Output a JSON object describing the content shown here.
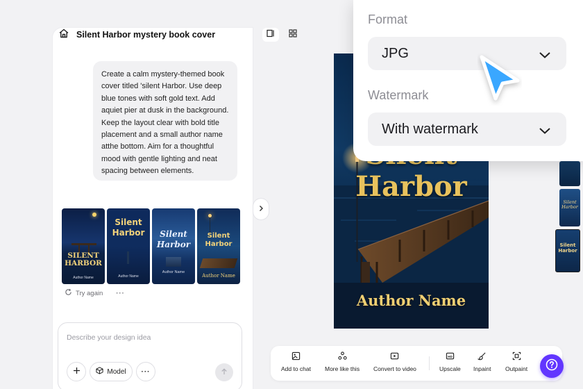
{
  "chat": {
    "title": "Silent Harbor mystery book cover",
    "prompt_message": "Create a calm mystery-themed book cover titled 'silent Harbor. Use deep blue tones with soft gold text. Add aquiet pier at dusk in the background. Keep the layout clear with bold title placement and a small author name atthe bottom. Aim for a thoughtful mood with gentle lighting and neat spacing between elements.",
    "thumbnails": [
      {
        "title": "SILENT HARBOR",
        "author": "Author Name"
      },
      {
        "title": "Silent Harbor",
        "author": "Author Name"
      },
      {
        "title": "Silent Harbor",
        "author": "Author Name"
      },
      {
        "title": "Silent Harbor",
        "author": "Author Name"
      }
    ],
    "try_again": "Try again",
    "more": "···",
    "input_placeholder": "Describe your design idea",
    "model_label": "Model",
    "dots_label": "···"
  },
  "cover": {
    "title_line1": "Silent",
    "title_line2": "Harbor",
    "author": "Author Name"
  },
  "toolbar": {
    "add_to_chat": "Add to chat",
    "more_like_this": "More like this",
    "convert_to_video": "Convert to video",
    "upscale": "Upscale",
    "inpaint": "Inpaint",
    "outpaint": "Outpaint"
  },
  "popup": {
    "format_label": "Format",
    "format_value": "JPG",
    "watermark_label": "Watermark",
    "watermark_value": "With watermark"
  },
  "colors": {
    "accent": "#6236ff",
    "cursor": "#3aa7ff",
    "cover_gold": "#e8c25d",
    "cover_navy": "#0e2447"
  }
}
